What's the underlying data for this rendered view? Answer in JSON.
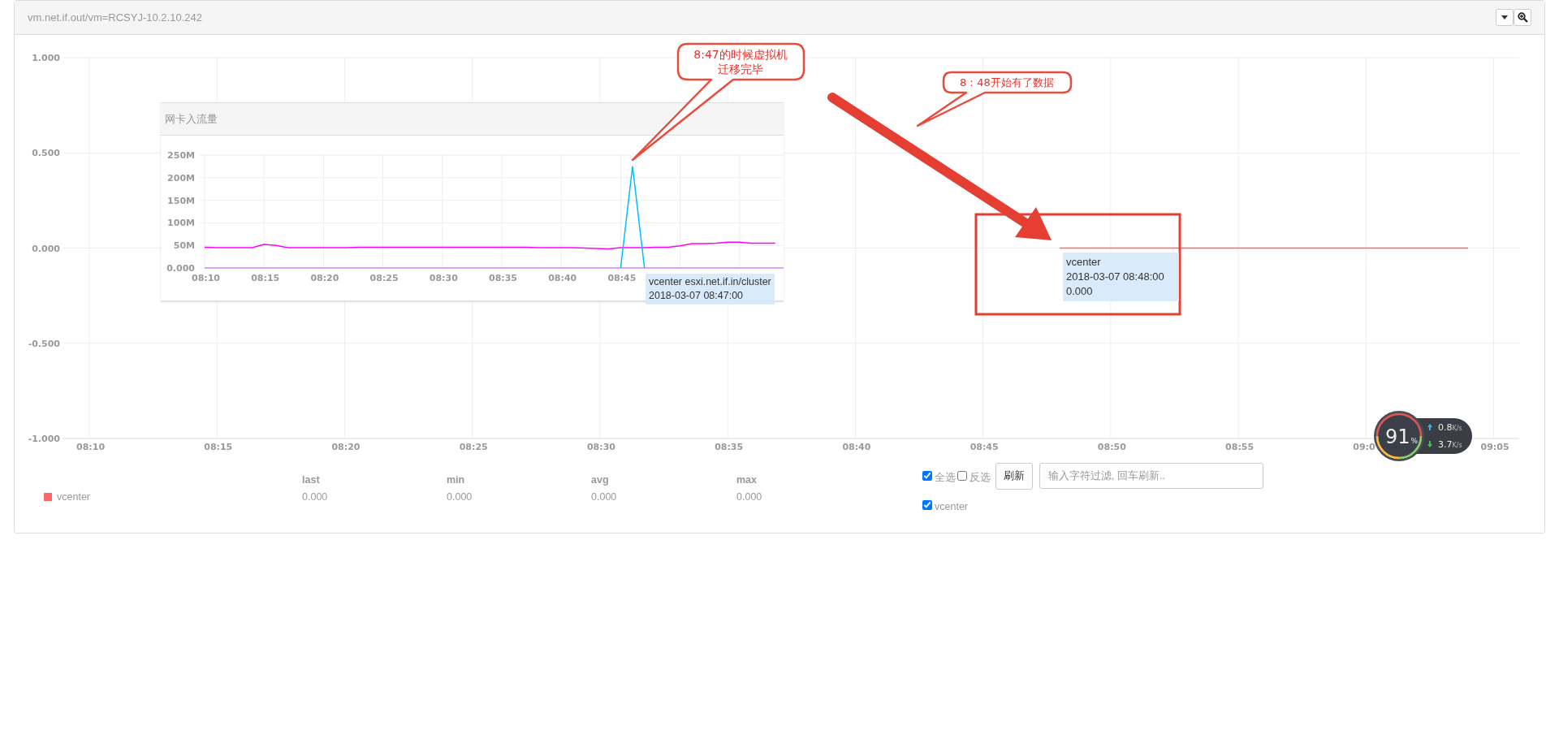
{
  "panel": {
    "title": "vm.net.if.out/vm=RCSYJ-10.2.10.242"
  },
  "main_chart": {
    "chart_data": {
      "type": "line",
      "grid": true,
      "ylim": [
        -1,
        1
      ],
      "categories": [
        null,
        "08:10",
        null,
        null,
        null,
        null,
        "08:15",
        null,
        null,
        null,
        null,
        "08:20",
        null,
        null,
        null,
        null,
        "08:25",
        null,
        null,
        null,
        null,
        "08:30",
        null,
        null,
        null,
        null,
        "08:35",
        null,
        null,
        null,
        null,
        "08:40",
        null,
        null,
        null,
        null,
        "08:45",
        null,
        null,
        null,
        null,
        "08:50",
        null,
        null,
        null,
        null,
        "08:55",
        null,
        null,
        null,
        null,
        "09:0",
        null,
        null,
        null,
        null,
        "09:05",
        null
      ],
      "yticks": [
        {
          "value": 1,
          "label": "1.000"
        },
        {
          "value": 0.5,
          "label": "0.500"
        },
        {
          "value": 0,
          "label": "0.000"
        },
        {
          "value": -0.5,
          "label": "-0.500"
        },
        {
          "value": -1,
          "label": "-1.000"
        }
      ],
      "series": [
        {
          "name": "vcenter",
          "color": "#ff6666",
          "values": [
            null,
            null,
            null,
            null,
            null,
            null,
            null,
            null,
            null,
            null,
            null,
            null,
            null,
            null,
            null,
            null,
            null,
            null,
            null,
            null,
            null,
            null,
            null,
            null,
            null,
            null,
            null,
            null,
            null,
            null,
            null,
            null,
            null,
            null,
            null,
            null,
            null,
            null,
            null,
            0,
            0,
            0,
            0,
            0,
            0,
            0,
            0,
            0,
            0,
            0,
            0,
            0,
            0,
            0,
            0,
            0,
            null,
            null
          ]
        }
      ]
    },
    "tooltip": {
      "lines": [
        "vcenter",
        "2018-03-07 08:48:00",
        "0.000"
      ]
    }
  },
  "inset": {
    "title": "网卡入流量",
    "chart_data": {
      "type": "line",
      "grid": true,
      "ylim": [
        0,
        250
      ],
      "categories": [
        "08:10",
        null,
        null,
        null,
        null,
        "08:15",
        null,
        null,
        null,
        null,
        "08:20",
        null,
        null,
        null,
        null,
        "08:25",
        null,
        null,
        null,
        null,
        "08:30",
        null,
        null,
        null,
        null,
        "08:35",
        null,
        null,
        null,
        null,
        "08:40",
        null,
        null,
        null,
        null,
        "08:45",
        null,
        null,
        null,
        null,
        null,
        null,
        null,
        null,
        null,
        null,
        null,
        null,
        null,
        null
      ],
      "yticks": [
        {
          "value": 0,
          "label": "0.000"
        },
        {
          "value": 50,
          "label": "50M"
        },
        {
          "value": 100,
          "label": "100M"
        },
        {
          "value": 150,
          "label": "150M"
        },
        {
          "value": 200,
          "label": "200M"
        },
        {
          "value": 250,
          "label": "250M"
        }
      ],
      "series": [
        {
          "color": "#ff00ff",
          "values": [
            46,
            45,
            45,
            45,
            45,
            52,
            50,
            45,
            45,
            45,
            45,
            45,
            45,
            46,
            46,
            46,
            46,
            46,
            46,
            46,
            46,
            46,
            46,
            46,
            46,
            46,
            46,
            46,
            45,
            45,
            45,
            45,
            44,
            43,
            42,
            45,
            45,
            45,
            46,
            46,
            49,
            54,
            54,
            55,
            57,
            57,
            55,
            55,
            55,
            null
          ]
        },
        {
          "color": "#cc88ff",
          "values": [
            0,
            0,
            0,
            0,
            0,
            0,
            0,
            0,
            0,
            0,
            0,
            0,
            0,
            0,
            0,
            0,
            0,
            0,
            0,
            0,
            0,
            0,
            0,
            0,
            0,
            0,
            0,
            0,
            0,
            0,
            0,
            0,
            0,
            0,
            0,
            0,
            0,
            0,
            0,
            0,
            0,
            0,
            0,
            0,
            0,
            0,
            0,
            0,
            0,
            0
          ]
        },
        {
          "color": "#00bfff",
          "values": [
            null,
            null,
            null,
            null,
            null,
            null,
            null,
            null,
            null,
            null,
            null,
            null,
            null,
            null,
            null,
            null,
            null,
            null,
            null,
            null,
            null,
            null,
            null,
            null,
            null,
            null,
            null,
            null,
            null,
            null,
            null,
            null,
            null,
            null,
            null,
            0,
            225,
            0,
            null,
            null,
            null,
            null,
            null,
            null,
            null,
            null,
            null,
            null,
            null,
            null
          ]
        }
      ]
    },
    "tooltip": {
      "lines": [
        "vcenter esxi.net.if.in/cluster",
        "2018-03-07 08:47:00"
      ]
    }
  },
  "annotations": [
    {
      "lines": [
        "8:47的时候虚拟机",
        "迁移完毕"
      ]
    },
    {
      "lines": [
        "8：48开始有了数据"
      ]
    }
  ],
  "legend": {
    "columns": [
      "last",
      "min",
      "avg",
      "max"
    ],
    "rows": [
      {
        "values": [
          "0.000",
          "0.000",
          "0.000",
          "0.000"
        ]
      }
    ]
  },
  "filter": {
    "select_all": {
      "label": "全选",
      "checked": true
    },
    "invert": {
      "label": "反选",
      "checked": false
    },
    "refresh_button": "刷新",
    "search": {
      "placeholder": "输入字符过滤, 回车刷新.."
    },
    "series": [
      {
        "label": "vcenter",
        "checked": true
      }
    ]
  },
  "network_widget": {
    "percent": "91",
    "percent_unit": "%",
    "upload": "0.8",
    "upload_unit": "K/s",
    "download": "3.7",
    "download_unit": "K/s"
  }
}
